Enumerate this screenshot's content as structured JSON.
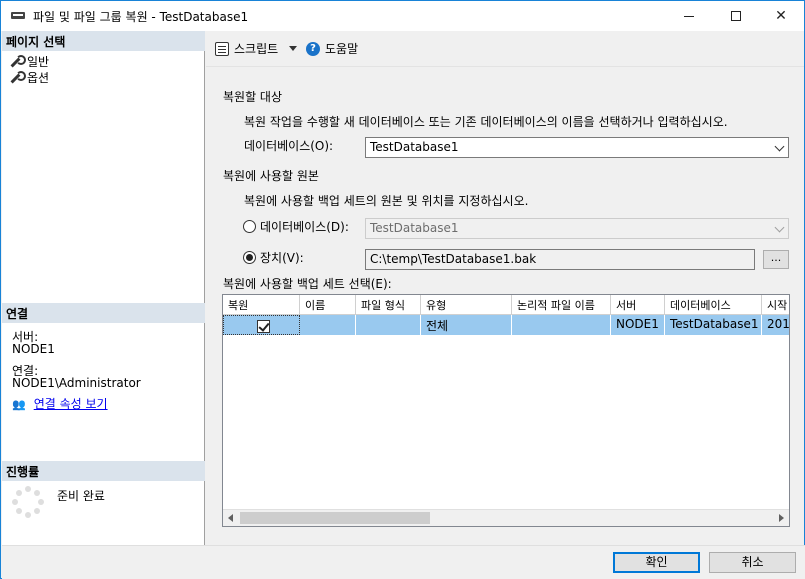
{
  "window": {
    "title": "파일 및 파일 그룹 복원 - TestDatabase1"
  },
  "left": {
    "page_select_header": "페이지 선택",
    "nav": [
      "일반",
      "옵션"
    ],
    "connection_header": "연결",
    "server_label": "서버:",
    "server_value": "NODE1",
    "connection_label": "연결:",
    "connection_value": "NODE1\\Administrator",
    "view_props_link": "연결 속성 보기",
    "progress_header": "진행률",
    "progress_status": "준비 완료"
  },
  "toolbar": {
    "script_label": "스크립트",
    "help_label": "도움말"
  },
  "main": {
    "restore_target_header": "복원할 대상",
    "restore_target_desc": "복원 작업을 수행할 새 데이터베이스 또는 기존 데이터베이스의 이름을 선택하거나 입력하십시오.",
    "database_label": "데이터베이스(O):",
    "database_value": "TestDatabase1",
    "source_header": "복원에 사용할 원본",
    "source_desc": "복원에 사용할 백업 세트의 원본 및 위치를 지정하십시오.",
    "from_database_label": "데이터베이스(D):",
    "from_database_value": "TestDatabase1",
    "device_label": "장치(V):",
    "device_value": "C:\\temp\\TestDatabase1.bak",
    "browse_label": "...",
    "backup_sets_label": "복원에 사용할 백업 세트 선택(E):",
    "grid": {
      "columns": [
        "복원",
        "이름",
        "파일 형식",
        "유형",
        "논리적 파일 이름",
        "서버",
        "데이터베이스",
        "시작"
      ],
      "rows": [
        {
          "restore": true,
          "name": "",
          "file_type": "",
          "type": "전체",
          "logical_name": "",
          "server": "NODE1",
          "database": "TestDatabase1",
          "start": "201"
        }
      ]
    }
  },
  "footer": {
    "ok_label": "확인",
    "cancel_label": "취소"
  },
  "colors": {
    "accent": "#0078d7",
    "selected_row": "#99c9ef",
    "header_bg": "#dae3ec",
    "link": "#0000ee"
  }
}
